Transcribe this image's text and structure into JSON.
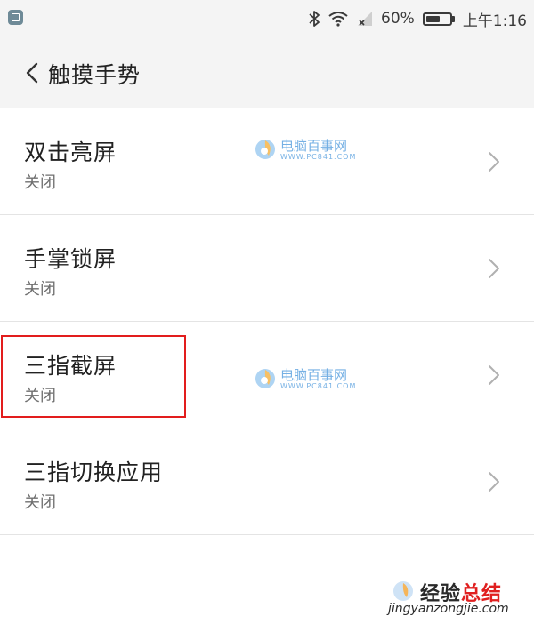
{
  "status_bar": {
    "battery_percent": "60%",
    "battery_level": 0.6,
    "time": "上午1:16"
  },
  "header": {
    "title": "触摸手势"
  },
  "settings": [
    {
      "title": "双击亮屏",
      "value": "关闭"
    },
    {
      "title": "手掌锁屏",
      "value": "关闭"
    },
    {
      "title": "三指截屏",
      "value": "关闭"
    },
    {
      "title": "三指切换应用",
      "value": "关闭"
    }
  ],
  "watermarks": {
    "site_name": "电脑百事网",
    "site_url": "WWW.PC841.COM",
    "corner_main_a": "经验",
    "corner_main_b": "总结",
    "corner_url": "jingyanzongjie.com"
  },
  "colors": {
    "highlight": "#e21d1d",
    "watermark_blue": "#3b8fd9",
    "background": "#ffffff",
    "bar_background": "#f4f4f4"
  },
  "icons": {
    "back": "chevron-left-icon",
    "row_arrow": "chevron-right-icon",
    "bluetooth": "bluetooth-icon",
    "wifi": "wifi-icon",
    "signal": "signal-icon",
    "battery": "battery-icon"
  }
}
